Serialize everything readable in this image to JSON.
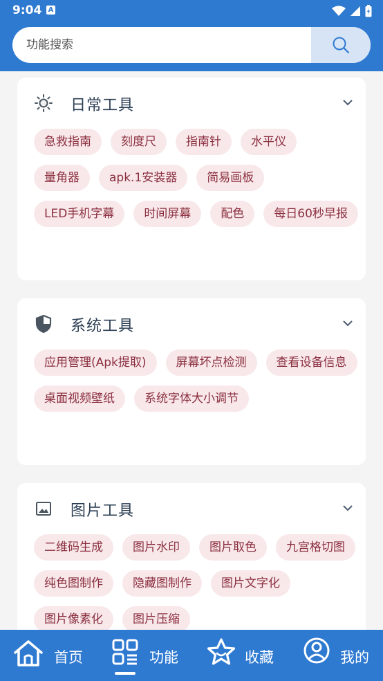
{
  "status": {
    "time": "9:04",
    "notif_glyph": "A"
  },
  "search": {
    "placeholder": "功能搜索",
    "value": ""
  },
  "sections": [
    {
      "title": "日常工具",
      "icon": "sun-icon",
      "items": [
        "急救指南",
        "刻度尺",
        "指南针",
        "水平仪",
        "量角器",
        "apk.1安装器",
        "简易画板",
        "LED手机字幕",
        "时间屏幕",
        "配色",
        "每日60秒早报"
      ]
    },
    {
      "title": "系统工具",
      "icon": "shield-icon",
      "items": [
        "应用管理(Apk提取)",
        "屏幕坏点检测",
        "查看设备信息",
        "桌面视频壁纸",
        "系统字体大小调节"
      ]
    },
    {
      "title": "图片工具",
      "icon": "image-icon",
      "items": [
        "二维码生成",
        "图片水印",
        "图片取色",
        "九宫格切图",
        "纯色图制作",
        "隐藏图制作",
        "图片文字化",
        "图片像素化",
        "图片压缩"
      ]
    }
  ],
  "nav": [
    {
      "label": "首页",
      "icon": "home-icon"
    },
    {
      "label": "功能",
      "icon": "grid-icon",
      "active": true
    },
    {
      "label": "收藏",
      "icon": "star-icon"
    },
    {
      "label": "我的",
      "icon": "user-icon"
    }
  ],
  "colors": {
    "primary": "#2f7ad1",
    "chip_bg": "#f8e8ea",
    "chip_text": "#8b2f3f",
    "title_text": "#2d3f55"
  }
}
